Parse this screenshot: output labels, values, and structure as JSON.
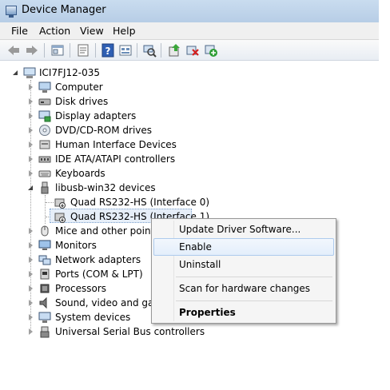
{
  "window": {
    "title": "Device Manager"
  },
  "menu": {
    "file": "File",
    "action": "Action",
    "view": "View",
    "help": "Help"
  },
  "toolbar": {
    "buttons": [
      "back-icon",
      "forward-icon",
      "show-hide-icon",
      "properties-icon",
      "help-icon",
      "view-icon",
      "scan-icon",
      "update-driver-icon",
      "disable-icon",
      "enable-icon"
    ]
  },
  "tree": {
    "root": "ICI7FJ12-035",
    "categories": [
      "Computer",
      "Disk drives",
      "Display adapters",
      "DVD/CD-ROM drives",
      "Human Interface Devices",
      "IDE ATA/ATAPI controllers",
      "Keyboards",
      "libusb-win32 devices",
      "Mice and other pointin",
      "Monitors",
      "Network adapters",
      "Ports (COM & LPT)",
      "Processors",
      "Sound, video and gam",
      "System devices",
      "Universal Serial Bus controllers"
    ],
    "children": [
      "Quad RS232-HS (Interface 0)",
      "Quad RS232-HS (Interface 1)"
    ]
  },
  "context_menu": {
    "update": "Update Driver Software...",
    "enable": "Enable",
    "uninstall": "Uninstall",
    "scan": "Scan for hardware changes",
    "properties": "Properties"
  }
}
